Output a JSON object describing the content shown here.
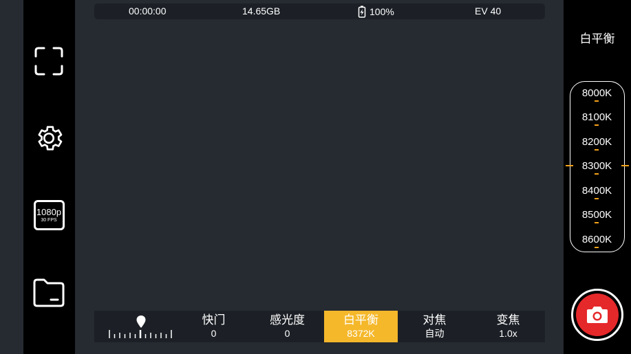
{
  "status": {
    "timer": "00:00:00",
    "storage": "14.65GB",
    "battery": "100%",
    "ev": "EV 40"
  },
  "left_toolbar": {
    "resolution": "1080p",
    "fps": "30 FPS",
    "icons": [
      "fullscreen-icon",
      "gear-icon",
      "resolution-icon",
      "folder-icon"
    ]
  },
  "white_balance": {
    "title": "白平衡",
    "options": [
      "8000K",
      "8100K",
      "8200K",
      "8300K",
      "8400K",
      "8500K",
      "8600K"
    ],
    "selected": "8300K"
  },
  "bottom_tabs": [
    {
      "label": "快门",
      "value": "0"
    },
    {
      "label": "感光度",
      "value": "0"
    },
    {
      "label": "白平衡",
      "value": "8372K"
    },
    {
      "label": "对焦",
      "value": "自动"
    },
    {
      "label": "变焦",
      "value": "1.0x"
    }
  ],
  "active_tab": "白平衡",
  "colors": {
    "accent": "#f5b82b",
    "tick": "#f5a31a",
    "shutter": "#e5282a",
    "background": "#262b31",
    "panel": "#1c2026"
  }
}
